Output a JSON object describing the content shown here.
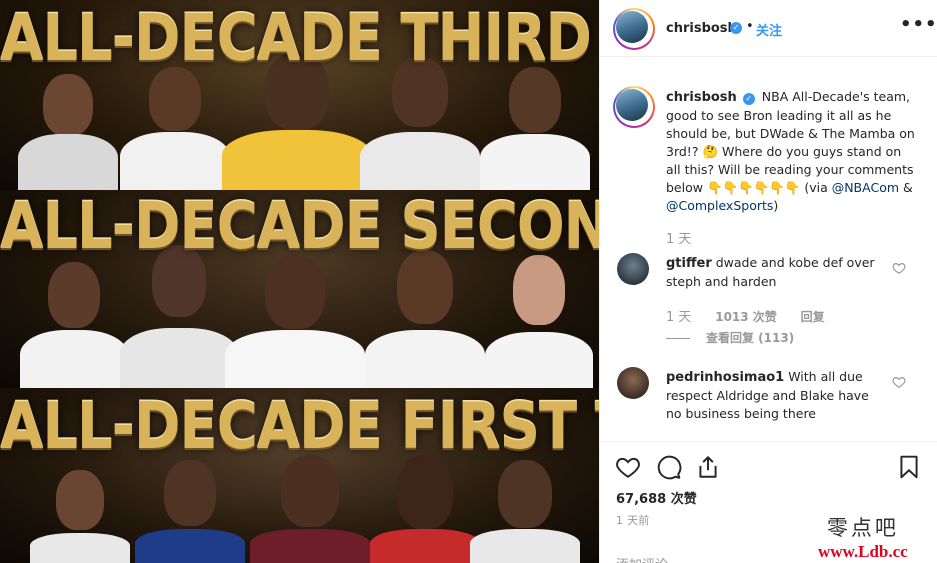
{
  "image": {
    "teams": [
      {
        "title": "ALL-DECADE THIRD TEAM"
      },
      {
        "title": "ALL-DECADE SECOND TEAM"
      },
      {
        "title": "ALL-DECADE FIRST TEAM"
      }
    ],
    "colors": {
      "gold": "#d9b35a",
      "background": "#1a1208"
    }
  },
  "header": {
    "username": "chrisbosh",
    "separator": "•",
    "follow_label": "关注",
    "more_icon": "more-options-icon",
    "more_glyph": "•••"
  },
  "caption": {
    "username": "chrisbosh",
    "text_part1": "NBA All-Decade's team, good to see Bron leading it all as he should be, but DWade & The Mamba on 3rd!? ",
    "emoji_1": "🤔",
    "text_part2": " Where do you guys stand on all this? Will be reading your comments below ",
    "emoji_2": "👇👇👇👇👇👇",
    "text_part3": " (via ",
    "mention_1": "@NBACom",
    "text_part4": " & ",
    "mention_2": "@ComplexSports",
    "text_part5": ")",
    "age": "1 天"
  },
  "comments": [
    {
      "username": "gtiffer",
      "text": "dwade and kobe def over steph and harden",
      "age": "1 天",
      "likes": "1013 次赞",
      "reply_label": "回复",
      "view_replies": "查看回复 (113)"
    },
    {
      "username": "pedrinhosimao1",
      "text": "With all due respect Aldridge and Blake have no business being there"
    }
  ],
  "actions": {
    "like_icon": "heart-icon",
    "comment_icon": "comment-icon",
    "share_icon": "share-icon",
    "save_icon": "bookmark-icon",
    "likes": "67,688 次赞",
    "time_ago": "1 天前",
    "add_comment_placeholder": "添加评论......"
  },
  "watermark": {
    "line1": "零点吧",
    "line2": "www.Ldb.cc"
  },
  "verified_glyph": "✓",
  "accent_color": "#3897f0"
}
